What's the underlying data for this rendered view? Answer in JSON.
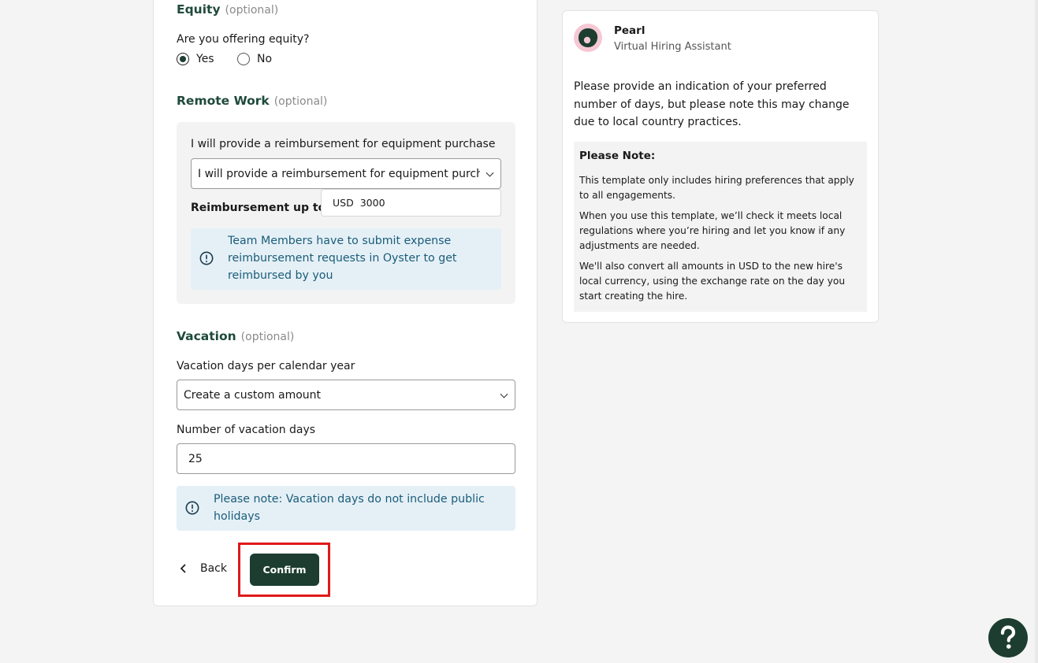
{
  "equity": {
    "title": "Equity",
    "optional": "(optional)",
    "question": "Are you offering equity?",
    "options": [
      "Yes",
      "No"
    ],
    "selected": "Yes"
  },
  "remote_work": {
    "title": "Remote Work",
    "optional": "(optional)",
    "reimbursement_label": "I will provide a reimbursement for equipment purchase",
    "reimbursement_select_value": "I will provide a reimbursement for equipment purchase",
    "up_to_label": "Reimbursement up to",
    "currency": "USD",
    "amount": "3000",
    "info": "Team Members have to submit expense reimbursement requests in Oyster to get reimbursed by you"
  },
  "vacation": {
    "title": "Vacation",
    "optional": "(optional)",
    "days_label": "Vacation days per calendar year",
    "days_select_value": "Create a custom amount",
    "number_label": "Number of vacation days",
    "number_value": "25",
    "info": "Please note: Vacation days do not include public holidays"
  },
  "actions": {
    "back_label": "Back",
    "confirm_label": "Confirm"
  },
  "assistant": {
    "name": "Pearl",
    "role": "Virtual Hiring Assistant",
    "message": "Please provide an indication of your preferred number of days, but please note this may change due to local country practices.",
    "note_title": "Please Note:",
    "note_paragraphs": [
      "This template only includes hiring preferences that apply to all engagements.",
      "When you use this template, we’ll check it meets local regulations where you’re hiring and let you know if any adjustments are needed.",
      "We'll also convert all amounts in USD to the new hire's local currency, using the exchange rate on the day you start creating the hire."
    ]
  },
  "colors": {
    "brand_green": "#1c3d30",
    "heading_green": "#1f4a3b",
    "info_bg": "#e5f0f6",
    "info_text": "#1a5c7a",
    "highlight_red": "#e0191a"
  },
  "icons": {
    "info": "info-circle-icon",
    "back": "chevron-left-icon",
    "select": "chevron-down-icon",
    "help": "question-mark-icon",
    "avatar": "pearl-avatar-icon"
  }
}
